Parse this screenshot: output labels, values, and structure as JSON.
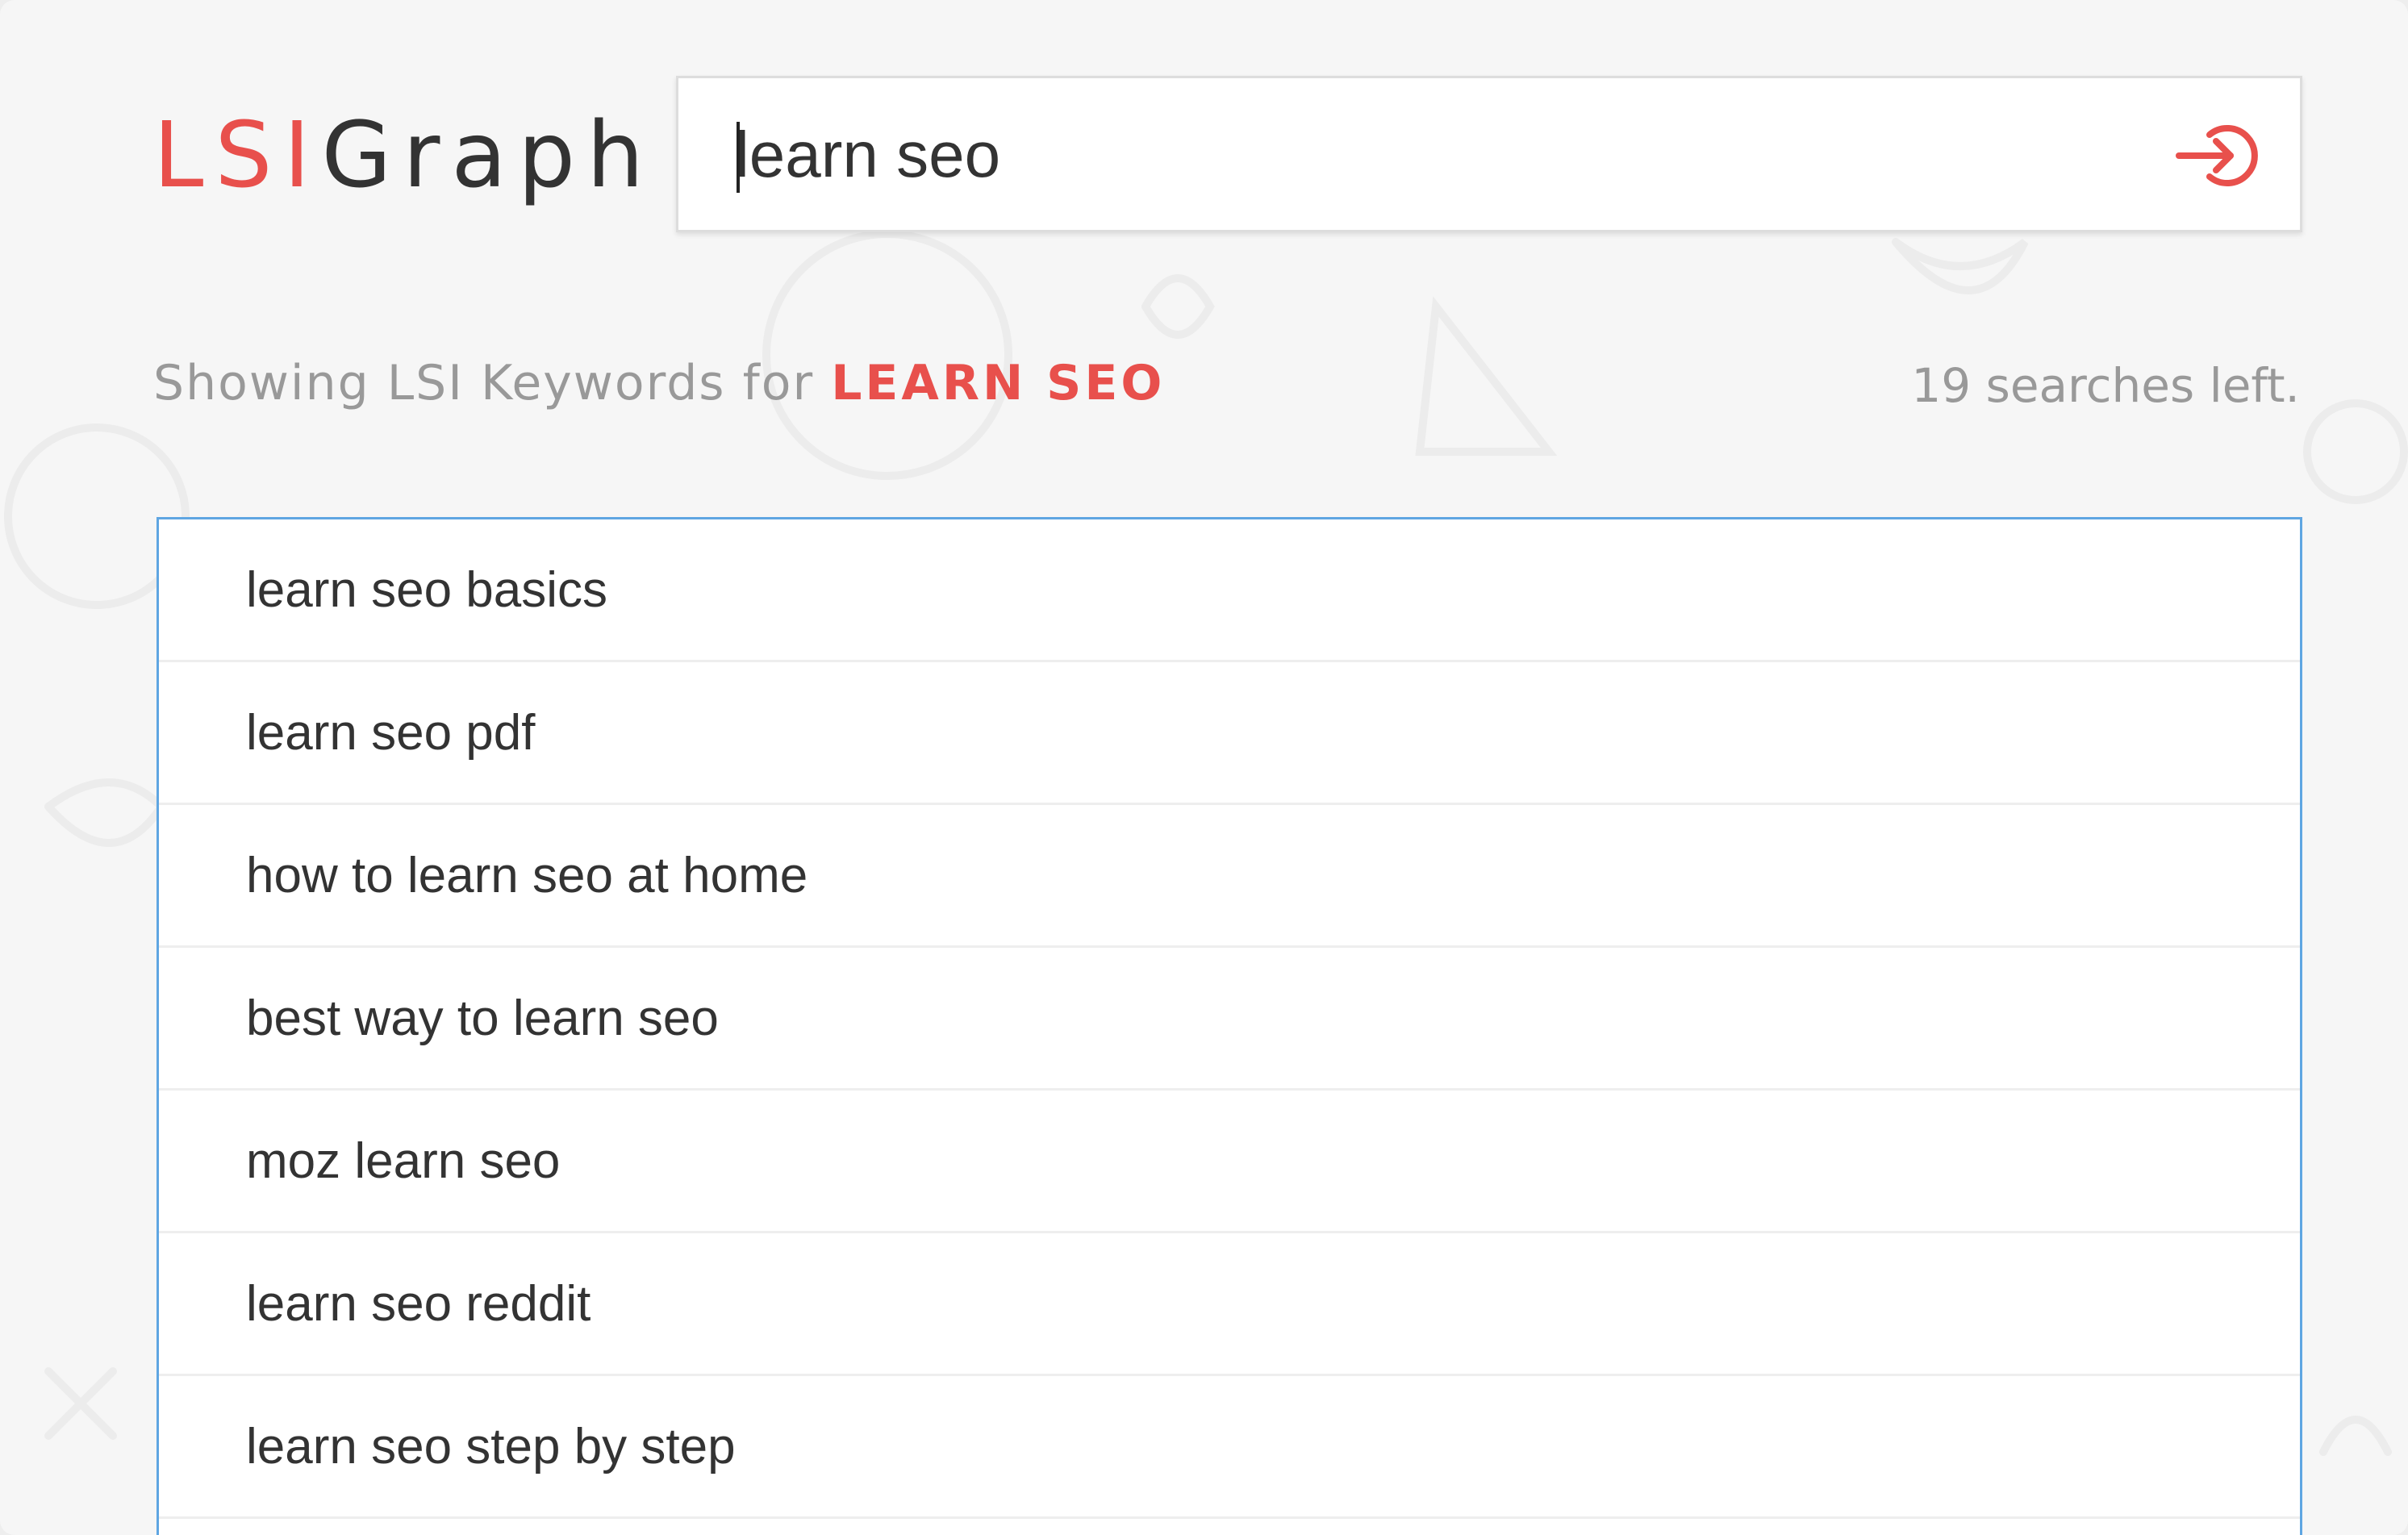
{
  "app": {
    "logo_lsi": "LSI",
    "logo_graph": "Graph"
  },
  "search": {
    "value": "learn seo",
    "submit_icon": "arrow-into-circle-icon"
  },
  "summary": {
    "prefix": "Showing LSI Keywords for",
    "keyword": "LEARN SEO",
    "searches_left": "19 searches left."
  },
  "results": [
    "learn seo basics",
    "learn seo pdf",
    "how to learn seo at home",
    "best way to learn seo",
    "moz learn seo",
    "learn seo reddit",
    "learn seo step by step"
  ],
  "colors": {
    "accent": "#e8504c",
    "border_focus": "#5fa6e2",
    "text": "#333333",
    "muted": "#999999"
  }
}
